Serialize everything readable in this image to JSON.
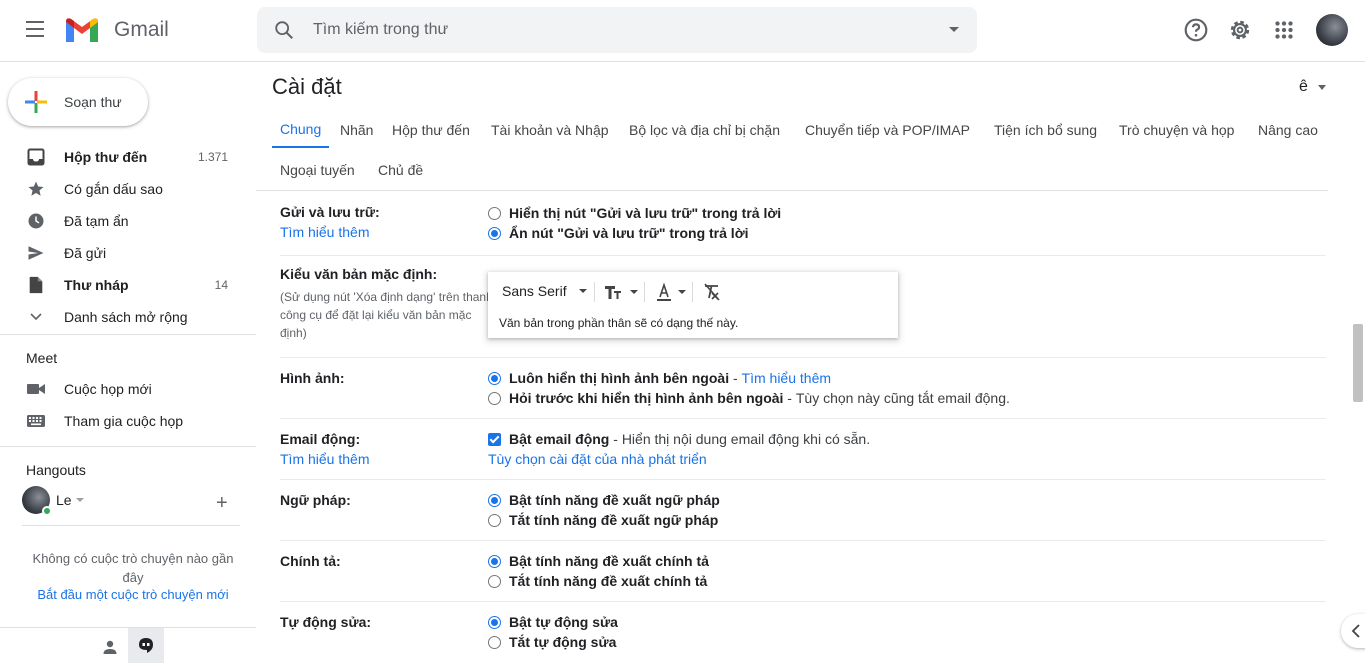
{
  "header": {
    "app_name": "Gmail",
    "search_placeholder": "Tìm kiếm trong thư"
  },
  "sidebar": {
    "compose_label": "Soạn thư",
    "items": [
      {
        "label": "Hộp thư đến",
        "count": "1.371",
        "icon": "inbox-icon",
        "bold": true
      },
      {
        "label": "Có gắn dấu sao",
        "count": "",
        "icon": "star-icon",
        "bold": false
      },
      {
        "label": "Đã tạm ẩn",
        "count": "",
        "icon": "clock-icon",
        "bold": false
      },
      {
        "label": "Đã gửi",
        "count": "",
        "icon": "send-icon",
        "bold": false
      },
      {
        "label": "Thư nháp",
        "count": "14",
        "icon": "draft-icon",
        "bold": true
      },
      {
        "label": "Danh sách mở rộng",
        "count": "",
        "icon": "chevron-down-icon",
        "bold": false
      }
    ],
    "meet": {
      "title": "Meet",
      "new_meeting": "Cuộc họp mới",
      "join_meeting": "Tham gia cuộc họp"
    },
    "hangouts": {
      "title": "Hangouts",
      "user_name": "Le",
      "no_chats": "Không có cuộc trò chuyện nào gần đây",
      "start_chat": "Bắt đầu một cuộc trò chuyện mới"
    }
  },
  "settings": {
    "title": "Cài đặt",
    "language_indicator": "ê",
    "tabs_row1": [
      "Chung",
      "Nhãn",
      "Hộp thư đến",
      "Tài khoản và Nhập",
      "Bộ lọc và địa chỉ bị chặn",
      "Chuyển tiếp và POP/IMAP",
      "Tiện ích bổ sung",
      "Trò chuyện và họp",
      "Nâng cao"
    ],
    "tabs_row2": [
      "Ngoại tuyến",
      "Chủ đề"
    ],
    "active_tab": "Chung",
    "rows": {
      "send_archive": {
        "label": "Gửi và lưu trữ:",
        "learn_more": "Tìm hiểu thêm",
        "opt1": "Hiển thị nút \"Gửi và lưu trữ\" trong trả lời",
        "opt2": "Ẩn nút \"Gửi và lưu trữ\" trong trả lời",
        "selected": 2
      },
      "default_text": {
        "label": "Kiểu văn bản mặc định:",
        "sub": "(Sử dụng nút 'Xóa định dạng' trên thanh công cụ để đặt lại kiểu văn bản mặc định)",
        "font": "Sans Serif",
        "sample": "Văn bản trong phần thân sẽ có dạng thế này."
      },
      "images": {
        "label": "Hình ảnh:",
        "opt1": "Luôn hiển thị hình ảnh bên ngoài",
        "opt1_link": "Tìm hiểu thêm",
        "opt2": "Hỏi trước khi hiển thị hình ảnh bên ngoài",
        "opt2_desc": "Tùy chọn này cũng tắt email động.",
        "selected": 1
      },
      "dynamic_email": {
        "label": "Email động:",
        "learn_more": "Tìm hiểu thêm",
        "opt1": "Bật email động",
        "opt1_desc": "Hiển thị nội dung email động khi có sẵn.",
        "dev_link": "Tùy chọn cài đặt của nhà phát triển",
        "checked": true
      },
      "grammar": {
        "label": "Ngữ pháp:",
        "opt1": "Bật tính năng đề xuất ngữ pháp",
        "opt2": "Tắt tính năng đề xuất ngữ pháp",
        "selected": 1
      },
      "spelling": {
        "label": "Chính tả:",
        "opt1": "Bật tính năng đề xuất chính tả",
        "opt2": "Tắt tính năng đề xuất chính tả",
        "selected": 1
      },
      "autocorrect": {
        "label": "Tự động sửa:",
        "opt1": "Bật tự động sửa",
        "opt2": "Tắt tự động sửa",
        "selected": 1
      }
    }
  },
  "colors": {
    "accent": "#1a73e8",
    "text": "#202124",
    "muted": "#5f6368"
  }
}
